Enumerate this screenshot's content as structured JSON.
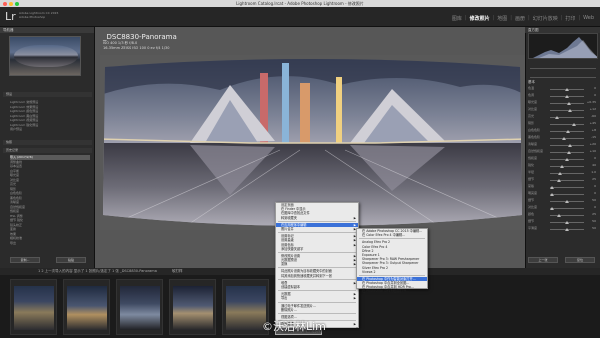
{
  "window": {
    "title": "Lightroom Catalog.lrcat - Adobe Photoshop Lightroom - 修改照片"
  },
  "identity": {
    "logo": "Lr",
    "line1": "Adobe Lightroom CC 2015",
    "line2": "Adobe Photoshop"
  },
  "modules": [
    "图库",
    "修改照片",
    "地图",
    "画册",
    "幻灯片放映",
    "打印",
    "Web"
  ],
  "active_module": "修改照片",
  "left_panel": {
    "navigator_header": "导航器",
    "presets_header": "预设",
    "presets": [
      "Lightroom 常规预设",
      "Lightroom 效果预设",
      "Lightroom 颜色预设",
      "Lightroom 黑白预设",
      "Lightroom 视频预设",
      "Lightroom 锐化预设",
      "用户预设"
    ],
    "snapshots_header": "快照",
    "history_header": "历史记录",
    "history": [
      "导入 (2017/2/6)",
      "调整曲线",
      "基本设置",
      "白平衡",
      "曝光度",
      "对比度",
      "高光",
      "阴影",
      "白色色阶",
      "黑色色阶",
      "清晰度",
      "自然饱和度",
      "饱和度",
      "HSL 调整",
      "细节 锐化",
      "镜头校正",
      "变换",
      "效果",
      "相机校准",
      "导出"
    ],
    "copy_button": "复制...",
    "paste_button": "粘贴"
  },
  "photo_info": {
    "title": "_DSC8830-Panorama",
    "line1": "ISO 400  1/3 秒  f/8.0",
    "line2": "16-35mm  ZEISS  ISO 100  0 ev  f/4  1/30"
  },
  "right_panel": {
    "histogram_label": "直方图",
    "basic_header": "基本",
    "sliders": [
      {
        "label": "色温",
        "value": "0",
        "pos": 0.5
      },
      {
        "label": "色调",
        "value": "0",
        "pos": 0.5
      },
      {
        "label": "曝光度",
        "value": "+0.35",
        "pos": 0.56
      },
      {
        "label": "对比度",
        "value": "+12",
        "pos": 0.6
      },
      {
        "label": "高光",
        "value": "-60",
        "pos": 0.2
      },
      {
        "label": "阴影",
        "value": "+45",
        "pos": 0.72
      },
      {
        "label": "白色色阶",
        "value": "+8",
        "pos": 0.54
      },
      {
        "label": "黑色色阶",
        "value": "-15",
        "pos": 0.42
      },
      {
        "label": "清晰度",
        "value": "+20",
        "pos": 0.6
      },
      {
        "label": "自然饱和度",
        "value": "+10",
        "pos": 0.55
      },
      {
        "label": "饱和度",
        "value": "0",
        "pos": 0.5
      },
      {
        "label": "锐化",
        "value": "40",
        "pos": 0.35
      },
      {
        "label": "半径",
        "value": "1.0",
        "pos": 0.3
      },
      {
        "label": "细节",
        "value": "25",
        "pos": 0.25
      },
      {
        "label": "蒙版",
        "value": "0",
        "pos": 0.05
      },
      {
        "label": "明亮度",
        "value": "0",
        "pos": 0.05
      },
      {
        "label": "细节",
        "value": "50",
        "pos": 0.5
      },
      {
        "label": "对比度",
        "value": "0",
        "pos": 0.05
      },
      {
        "label": "颜色",
        "value": "25",
        "pos": 0.25
      },
      {
        "label": "细节",
        "value": "50",
        "pos": 0.5
      },
      {
        "label": "平滑度",
        "value": "50",
        "pos": 0.5
      }
    ],
    "previous_button": "上一张",
    "reset_button": "复位"
  },
  "filmstrip": {
    "source_label": "1  2  上一次导入的内容  显示了 1 张照片/选定了 1 张  _DSC8830-Panorama",
    "soft_proof_label": "软打样"
  },
  "context_menu": {
    "items": [
      {
        "label": "设定页面",
        "arrow": false
      },
      {
        "label": "在 Finder 中显示",
        "arrow": false
      },
      {
        "label": "在图库中查找此文件",
        "arrow": false
      },
      {
        "label": "转到收藏夹",
        "arrow": true
      },
      {
        "label": "sep"
      },
      {
        "label": "在应用程序中编辑",
        "arrow": true,
        "hi": true
      },
      {
        "label": "照片合并",
        "arrow": true
      },
      {
        "label": "sep"
      },
      {
        "label": "设置标记",
        "arrow": true
      },
      {
        "label": "设置星级",
        "arrow": true
      },
      {
        "label": "设置色标",
        "arrow": true
      },
      {
        "label": "添加快捷关键字",
        "arrow": false
      },
      {
        "label": "sep"
      },
      {
        "label": "修改照片设置",
        "arrow": true
      },
      {
        "label": "元数据预设",
        "arrow": true
      },
      {
        "label": "变换",
        "arrow": true
      },
      {
        "label": "sep"
      },
      {
        "label": "将此照片设置为目标收藏夹中的封面",
        "arrow": false
      },
      {
        "label": "将其添加到快速收藏夹并转到下一张",
        "arrow": false
      },
      {
        "label": "sep"
      },
      {
        "label": "堆叠",
        "arrow": true
      },
      {
        "label": "创建虚拟副本",
        "arrow": false
      },
      {
        "label": "sep"
      },
      {
        "label": "元数据",
        "arrow": true
      },
      {
        "label": "导出",
        "arrow": true
      },
      {
        "label": "sep"
      },
      {
        "label": "通过电子邮件发送照片...",
        "arrow": false
      },
      {
        "label": "删除照片...",
        "arrow": false
      },
      {
        "label": "sep"
      },
      {
        "label": "视图选项...",
        "arrow": false
      },
      {
        "label": "sep"
      },
      {
        "label": "背景选项",
        "arrow": true
      },
      {
        "label": "sep"
      },
      {
        "label": "将此照片设置为虚拟副本的封面",
        "arrow": false
      }
    ],
    "submenu": [
      {
        "label": "在 Adobe Photoshop CC 2015 中编辑..."
      },
      {
        "label": "在 Color Efex Pro 4 中编辑..."
      },
      {
        "label": "sep"
      },
      {
        "label": "Analog Efex Pro 2"
      },
      {
        "label": "Color Efex Pro 4"
      },
      {
        "label": "Dfine 2"
      },
      {
        "label": "Exposure 1"
      },
      {
        "label": "Sharpener Pro 3: RAW Presharpener"
      },
      {
        "label": "Sharpener Pro 3: Output Sharpener"
      },
      {
        "label": "Silver Efex Pro 2"
      },
      {
        "label": "Viveza 2"
      },
      {
        "label": "sep"
      },
      {
        "label": "在 Photoshop 中作为智能对象打开...",
        "hi": true
      },
      {
        "label": "在 Photoshop 中合并到全景图..."
      },
      {
        "label": "在 Photoshop 中合并到 HDR Pro..."
      },
      {
        "label": "在 Photoshop 中作为图层打开..."
      }
    ]
  },
  "watermark": "©沃沽林Lim",
  "colors": {
    "highlight": "#3b71d8",
    "panel": "#2b2b2b",
    "canvas": "#575757"
  }
}
